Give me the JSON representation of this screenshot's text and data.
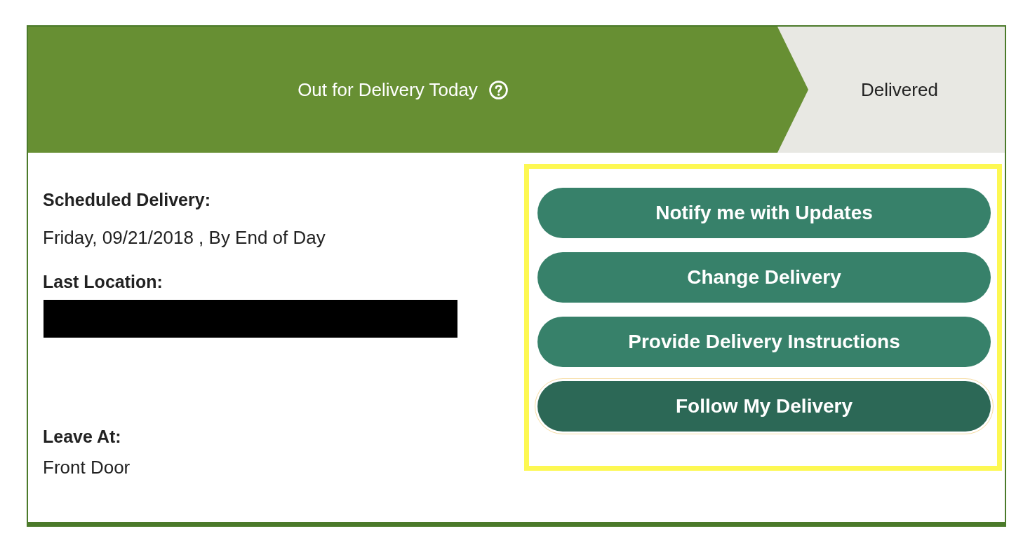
{
  "progress": {
    "steps": [
      {
        "label": "Out for Delivery Today",
        "active": true,
        "help": true
      },
      {
        "label": "Delivered",
        "active": false,
        "help": false
      }
    ]
  },
  "details": {
    "fields": [
      {
        "kind": "text",
        "label": "Scheduled Delivery:",
        "value": "Friday, 09/21/2018 , By End of Day"
      },
      {
        "kind": "redacted",
        "label": "Last Location:"
      },
      {
        "kind": "text",
        "label": "Leave At:",
        "value": "Front Door"
      }
    ]
  },
  "actions": {
    "highlighted": true,
    "buttons": [
      {
        "label": "Notify me with Updates",
        "focused": false
      },
      {
        "label": "Change Delivery",
        "focused": false
      },
      {
        "label": "Provide Delivery Instructions",
        "focused": false
      },
      {
        "label": "Follow My Delivery",
        "focused": true
      }
    ]
  }
}
